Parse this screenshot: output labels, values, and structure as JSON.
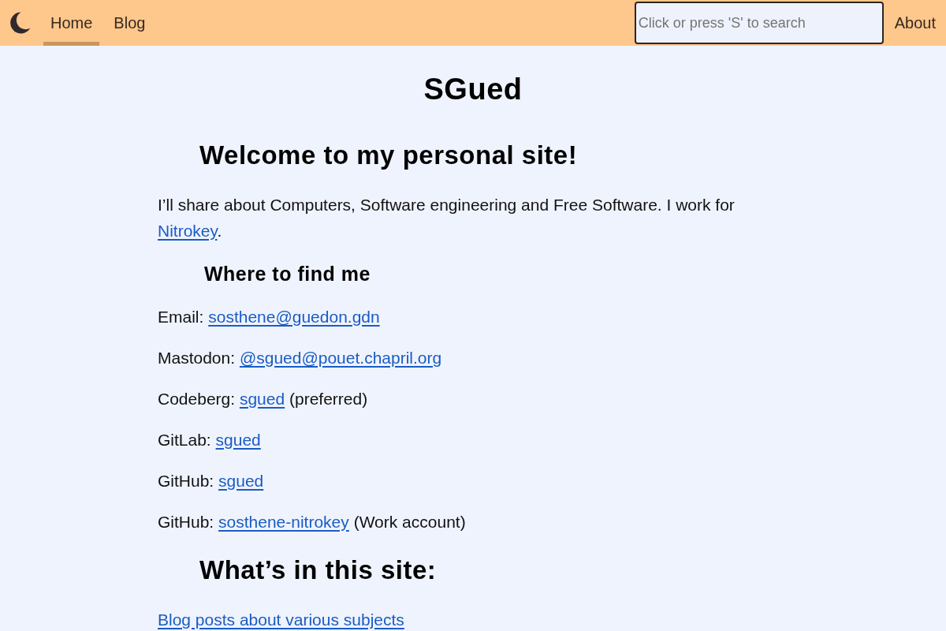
{
  "header": {
    "nav": [
      {
        "label": "Home",
        "selected": true
      },
      {
        "label": "Blog",
        "selected": false
      }
    ],
    "search": {
      "placeholder": "Click or press 'S' to search"
    },
    "about": "About"
  },
  "main": {
    "title": "SGued",
    "blocks": [
      {
        "kind": "heading",
        "text": "Welcome to my personal site!"
      },
      {
        "kind": "paragraph",
        "text": "I’ll share about Computers, Software engineering and Free Software. I work for",
        "link": "Nitrokey",
        "punct": "."
      },
      {
        "kind": "subheading",
        "text": "Where to find me"
      },
      {
        "kind": "paragraph",
        "text": "Email:",
        "link": "sosthene@guedon.gdn"
      },
      {
        "kind": "paragraph",
        "text": "Mastodon:",
        "link": "@sgued@pouet.chapril.org"
      },
      {
        "kind": "paragraph",
        "text": "Codeberg:",
        "link": "sgued",
        "note": "(preferred)"
      },
      {
        "kind": "paragraph",
        "text": "GitLab:",
        "link": "sgued"
      },
      {
        "kind": "paragraph",
        "text": "GitHub:",
        "link": "sgued"
      },
      {
        "kind": "paragraph",
        "text": "GitHub:",
        "link": "sosthene-nitrokey",
        "note": "(Work account)"
      },
      {
        "kind": "heading",
        "text": "What’s in this site:"
      },
      {
        "kind": "paragraph",
        "link": "Blog posts about various subjects"
      }
    ]
  }
}
